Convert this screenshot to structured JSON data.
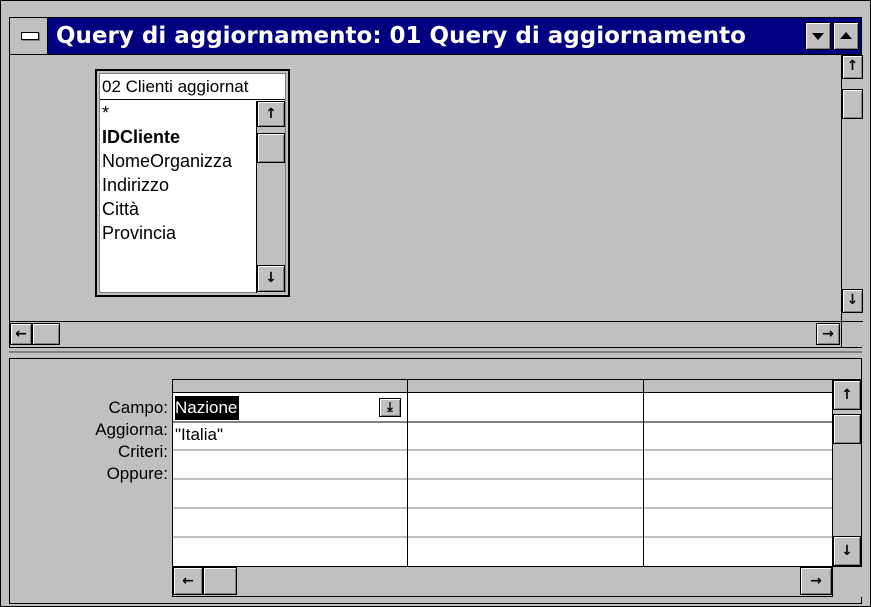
{
  "window": {
    "title": "Query di aggiornamento: 01 Query di aggiornamento"
  },
  "table": {
    "title": "02 Clienti aggiornat",
    "fields": [
      "*",
      "IDCliente",
      "NomeOrganizza",
      "Indirizzo",
      "Città",
      "Provincia"
    ]
  },
  "grid": {
    "row_labels": [
      "Campo:",
      "Aggiorna:",
      "Criteri:",
      "Oppure:"
    ],
    "campo": "Nazione",
    "aggiorna": "\"Italia\""
  },
  "icons": {
    "up": "↑",
    "down": "↓",
    "left": "←",
    "right": "→",
    "dropdown": "⤓"
  }
}
